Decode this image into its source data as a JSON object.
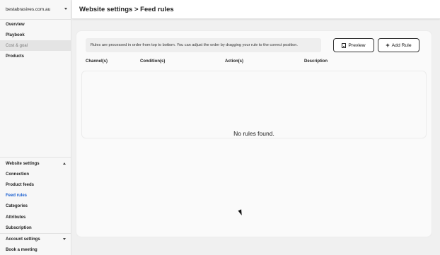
{
  "sidebar": {
    "site": "bestabrasives.com.au",
    "main_items": [
      {
        "label": "Overview"
      },
      {
        "label": "Playbook"
      },
      {
        "label": "Cost & goal"
      },
      {
        "label": "Products"
      }
    ],
    "website_settings": {
      "label": "Website settings",
      "items": [
        {
          "label": "Connection"
        },
        {
          "label": "Product feeds"
        },
        {
          "label": "Feed rules"
        },
        {
          "label": "Categories"
        },
        {
          "label": "Attributes"
        },
        {
          "label": "Subscription"
        }
      ]
    },
    "account_settings": {
      "label": "Account settings"
    },
    "book_meeting": "Book a meeting"
  },
  "header": {
    "title": "Website settings > Feed rules"
  },
  "main": {
    "info_text": "Rules are processed in order from top to bottom. You can adjust the order by dragging your rule to the correct position.",
    "preview_label": "Preview",
    "add_rule_label": "Add Rule",
    "columns": [
      "Channel(s)",
      "Condition(s)",
      "Action(s)",
      "Description"
    ],
    "empty_text": "No rules found."
  },
  "colors": {
    "active_link": "#1a5fd0",
    "active_bg": "#e4e4e4"
  }
}
